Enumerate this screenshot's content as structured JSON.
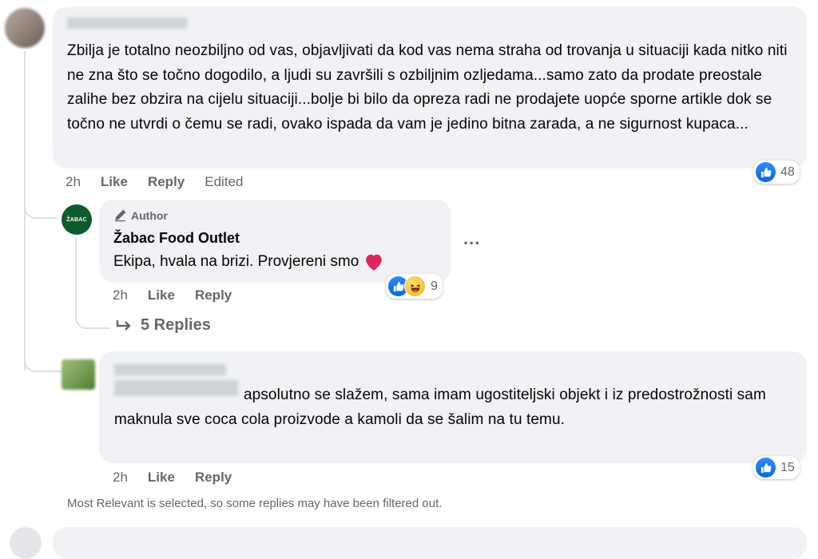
{
  "comment1": {
    "text": "Zbilja je totalno neozbiljno od vas, objavljivati da kod vas nema straha od trovanja u situaciji kada nitko niti ne zna što se točno dogodilo, a ljudi su završili s ozbiljnim ozljedama...samo zato da prodate preostale zalihe bez obzira na cijelu situaciji...bolje bi bilo da opreza radi ne prodajete uopće sporne artikle dok se točno ne utvrdi o čemu se radi, ovako ispada da vam je jedino bitna zarada, a ne sigurnost kupaca...",
    "time": "2h",
    "like": "Like",
    "reply": "Reply",
    "edited": "Edited",
    "reaction_count": "48"
  },
  "reply1": {
    "badge": "Author",
    "author": "Žabac Food Outlet",
    "avatar_text": "ŽABAC",
    "text": "Ekipa, hvala na brizi. Provjereni smo",
    "time": "2h",
    "like": "Like",
    "reply": "Reply",
    "reaction_count": "9",
    "more": "..."
  },
  "replies_link": "5 Replies",
  "comment2": {
    "text": "apsolutno se slažem, sama imam ugostiteljski objekt i iz predostrožnosti sam maknula sve coca cola proizvode a kamoli da se šalim na tu temu.",
    "time": "2h",
    "like": "Like",
    "reply": "Reply",
    "reaction_count": "15"
  },
  "filter_note": "Most Relevant is selected, so some replies may have been filtered out.",
  "colors": {
    "like_blue": "#1877f2",
    "bubble": "#f0f2f5",
    "author_green": "#0c5b2d"
  }
}
